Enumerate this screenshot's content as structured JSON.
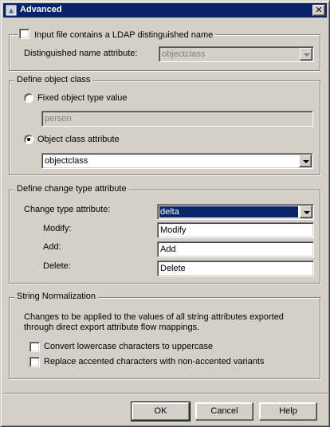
{
  "window": {
    "title": "Advanced",
    "close_glyph": "✕"
  },
  "ldap": {
    "checkbox_label": "Input file contains a LDAP distinguished name",
    "dn_attr_label": "Distinguished name attribute:",
    "dn_attr_value": "objectclass"
  },
  "object_class": {
    "legend": "Define object class",
    "fixed_label": "Fixed object type value",
    "fixed_value": "person",
    "attr_label": "Object class attribute",
    "attr_value": "objectclass"
  },
  "change_type": {
    "legend": "Define change type attribute",
    "attr_label": "Change type attribute:",
    "attr_value": "delta",
    "modify_label": "Modify:",
    "modify_value": "Modify",
    "add_label": "Add:",
    "add_value": "Add",
    "delete_label": "Delete:",
    "delete_value": "Delete"
  },
  "normalization": {
    "legend": "String Normalization",
    "desc_line1": "Changes to be applied to the values of all string attributes exported",
    "desc_line2": "through direct export attribute flow mappings.",
    "uppercase_label": "Convert lowercase characters to uppercase",
    "accent_label": "Replace accented characters with non-accented variants"
  },
  "buttons": {
    "ok": "OK",
    "cancel": "Cancel",
    "help": "Help"
  },
  "colors": {
    "face": "#d4d0c8",
    "title_bar": "#0a246a",
    "highlight": "#0a246a"
  }
}
